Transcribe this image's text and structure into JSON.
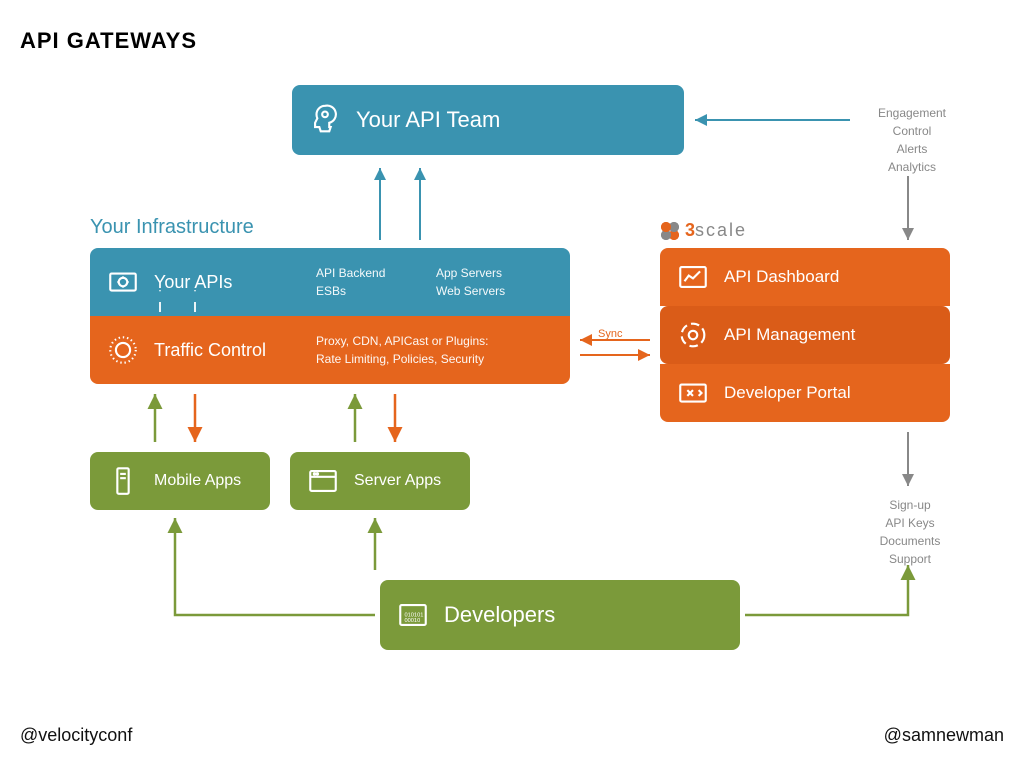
{
  "title": "API GATEWAYS",
  "apiteam": {
    "label": "Your API Team"
  },
  "infra": {
    "label": "Your Infrastructure"
  },
  "yourapis": {
    "label": "Your APIs",
    "sub1": "API Backend",
    "sub2": "ESBs",
    "sub3": "App Servers",
    "sub4": "Web Servers"
  },
  "traffic": {
    "label": "Traffic Control",
    "sub1": "Proxy, CDN, APICast or Plugins:",
    "sub2": "Rate Limiting, Policies, Security"
  },
  "mobile": {
    "label": "Mobile Apps"
  },
  "server": {
    "label": "Server Apps"
  },
  "devs": {
    "label": "Developers"
  },
  "logo": {
    "three": "3",
    "scale": "scale"
  },
  "dashboard": {
    "label": "API Dashboard"
  },
  "apimgmt": {
    "label": "API Management"
  },
  "devportal": {
    "label": "Developer Portal"
  },
  "annot_right": {
    "l1": "Engagement",
    "l2": "Control",
    "l3": "Alerts",
    "l4": "Analytics"
  },
  "annot_signup": {
    "l1": "Sign-up",
    "l2": "API Keys",
    "l3": "Documents",
    "l4": "Support"
  },
  "sync": "Sync",
  "footer": {
    "left": "@velocityconf",
    "right": "@samnewman"
  }
}
